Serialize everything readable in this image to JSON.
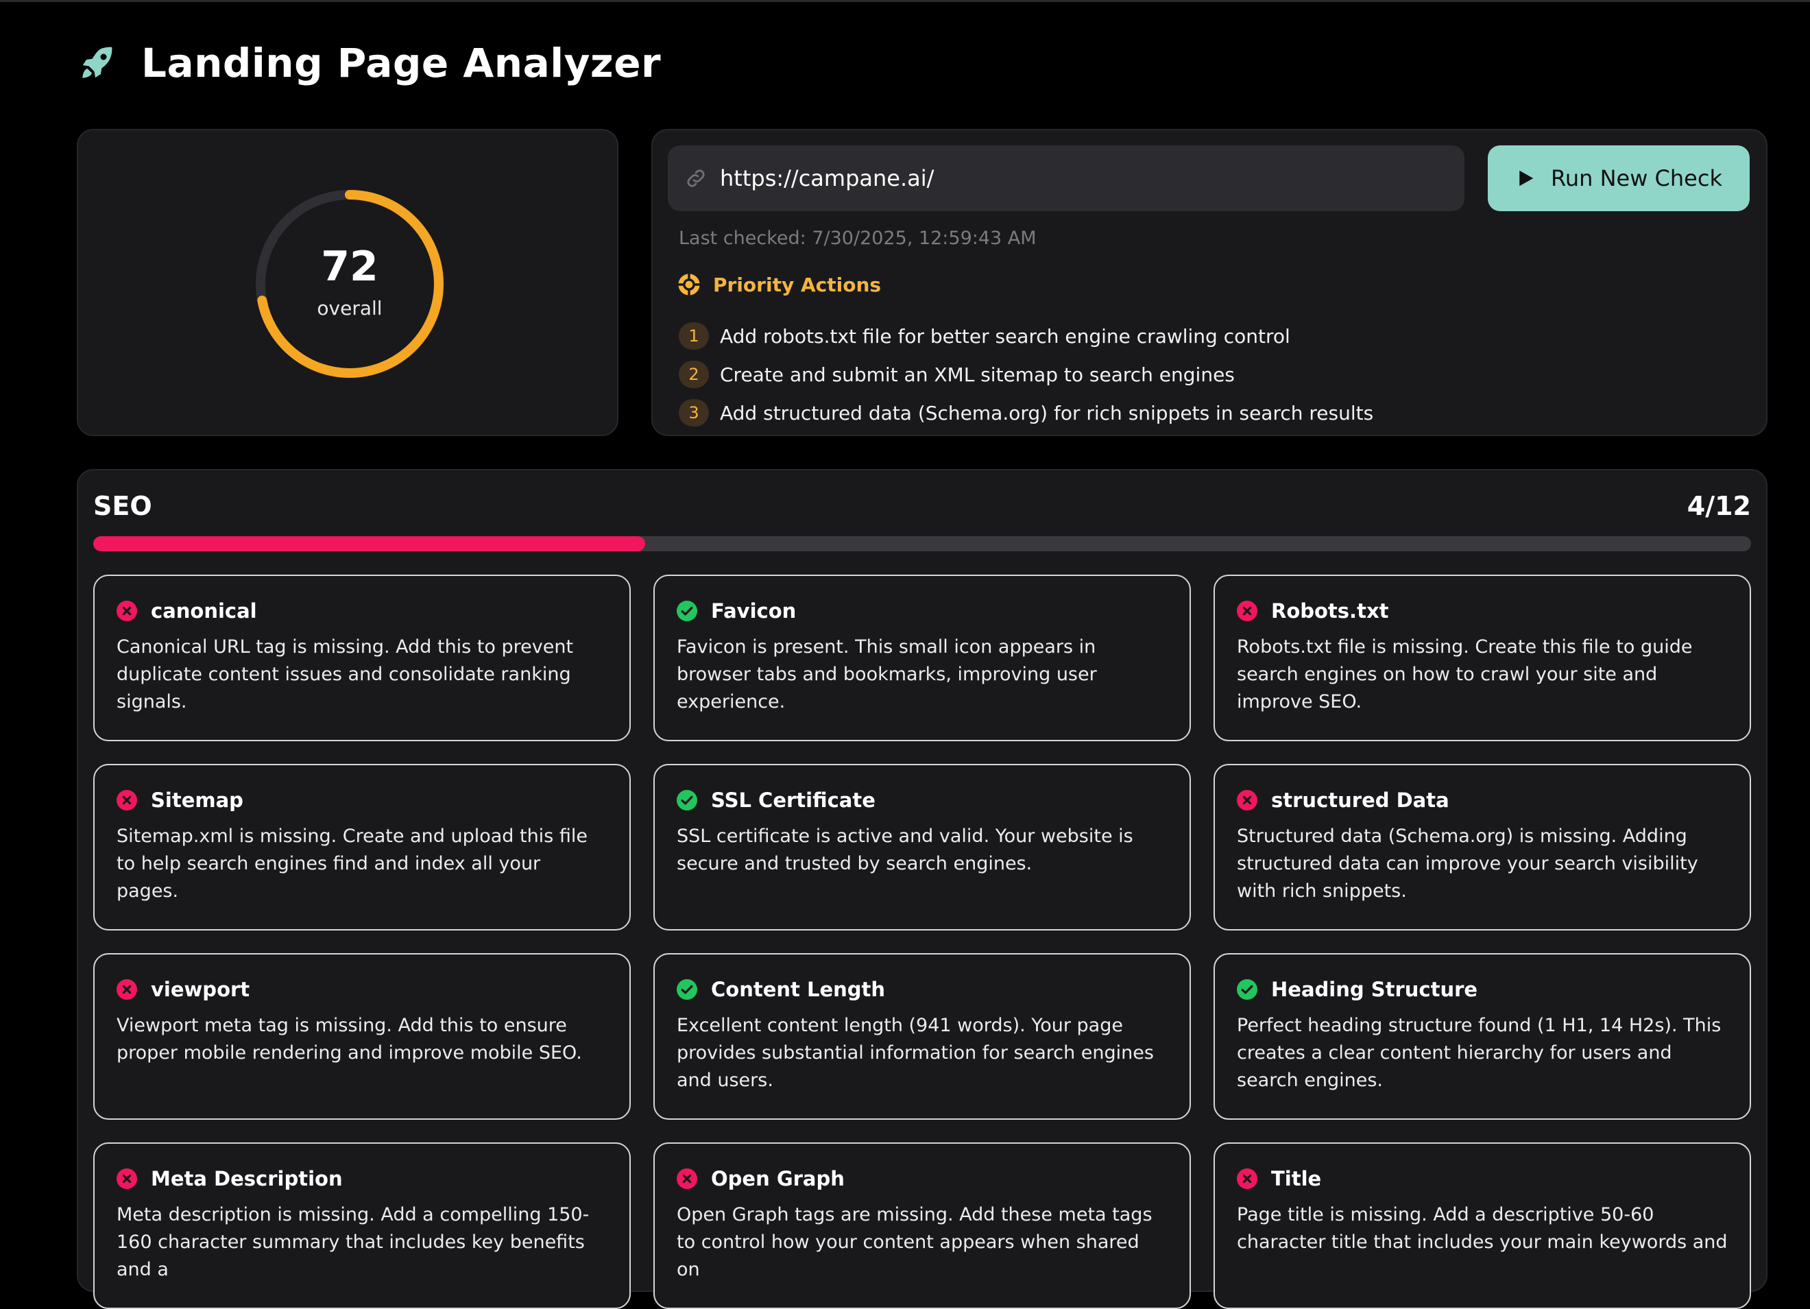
{
  "app": {
    "title": "Landing Page Analyzer"
  },
  "score": {
    "value": 72,
    "label": "overall",
    "fraction": 0.72,
    "color": "#f5a623"
  },
  "check": {
    "url": "https://campane.ai/",
    "run_button_label": "Run New Check",
    "last_checked": "Last checked: 7/30/2025, 12:59:43 AM"
  },
  "priority": {
    "title": "Priority Actions",
    "actions": [
      {
        "number": "1",
        "text": "Add robots.txt file for better search engine crawling control"
      },
      {
        "number": "2",
        "text": "Create and submit an XML sitemap to search engines"
      },
      {
        "number": "3",
        "text": "Add structured data (Schema.org) for rich snippets in search results"
      }
    ]
  },
  "seo": {
    "title": "SEO",
    "count": "4/12",
    "progress": 0.333,
    "items": [
      {
        "name": "canonical",
        "status": "fail",
        "desc": "Canonical URL tag is missing. Add this to prevent duplicate content issues and consolidate ranking signals."
      },
      {
        "name": "Favicon",
        "status": "pass",
        "desc": "Favicon is present. This small icon appears in browser tabs and bookmarks, improving user experience."
      },
      {
        "name": "Robots.txt",
        "status": "fail",
        "desc": "Robots.txt file is missing. Create this file to guide search engines on how to crawl your site and improve SEO."
      },
      {
        "name": "Sitemap",
        "status": "fail",
        "desc": "Sitemap.xml is missing. Create and upload this file to help search engines find and index all your pages."
      },
      {
        "name": "SSL Certificate",
        "status": "pass",
        "desc": "SSL certificate is active and valid. Your website is secure and trusted by search engines."
      },
      {
        "name": "structured Data",
        "status": "fail",
        "desc": "Structured data (Schema.org) is missing. Adding structured data can improve your search visibility with rich snippets."
      },
      {
        "name": "viewport",
        "status": "fail",
        "desc": "Viewport meta tag is missing. Add this to ensure proper mobile rendering and improve mobile SEO."
      },
      {
        "name": "Content Length",
        "status": "pass",
        "desc": "Excellent content length (941 words). Your page provides substantial information for search engines and users."
      },
      {
        "name": "Heading Structure",
        "status": "pass",
        "desc": "Perfect heading structure found (1 H1, 14 H2s). This creates a clear content hierarchy for users and search engines."
      },
      {
        "name": "Meta Description",
        "status": "fail",
        "desc": "Meta description is missing. Add a compelling 150-160 character summary that includes key benefits and a"
      },
      {
        "name": "Open Graph",
        "status": "fail",
        "desc": "Open Graph tags are missing. Add these meta tags to control how your content appears when shared on"
      },
      {
        "name": "Title",
        "status": "fail",
        "desc": "Page title is missing. Add a descriptive 50-60 character title that includes your main keywords and"
      }
    ]
  },
  "colors": {
    "accent": "#8fd6c9",
    "pass": "#22c55e",
    "fail": "#f0175d",
    "priority": "#f5b43f"
  },
  "icons": {
    "logo": "rocket-icon",
    "url": "link-icon",
    "run": "play-icon",
    "priority": "target-icon",
    "pass": "check-circle-icon",
    "fail": "x-circle-icon"
  }
}
